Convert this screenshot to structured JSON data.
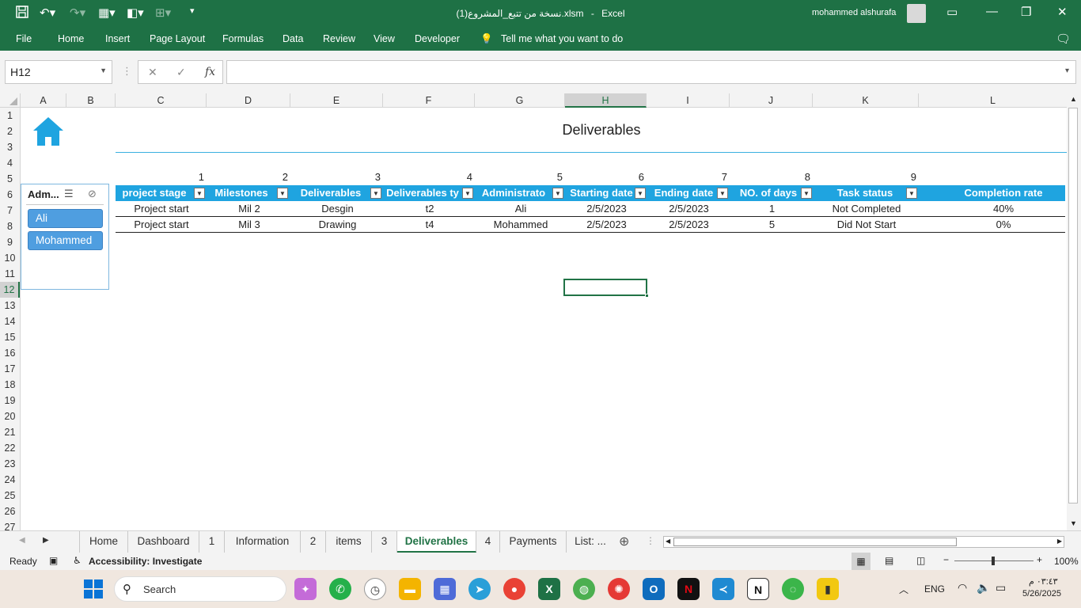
{
  "titlebar": {
    "filename": "نسخة من تتبع_المشروع(1).xlsm",
    "separator": "-",
    "app": "Excel",
    "user": "mohammed alshurafa"
  },
  "ribbon_tabs": [
    "File",
    "Home",
    "Insert",
    "Page Layout",
    "Formulas",
    "Data",
    "Review",
    "View",
    "Developer",
    "Tell me what you want to do"
  ],
  "formula_bar": {
    "name_box": "H12",
    "fx": "fx",
    "cancel": "✕",
    "enter": "✓",
    "value": ""
  },
  "columns": [
    "A",
    "B",
    "C",
    "D",
    "E",
    "F",
    "G",
    "H",
    "I",
    "J",
    "K",
    "L"
  ],
  "rows": [
    "1",
    "2",
    "3",
    "4",
    "5",
    "6",
    "7",
    "8",
    "9",
    "10",
    "11",
    "12",
    "13",
    "14",
    "15",
    "16",
    "17",
    "18",
    "19",
    "20",
    "21",
    "22",
    "23",
    "24",
    "25",
    "26",
    "27"
  ],
  "selected": {
    "column": "H",
    "row": "12"
  },
  "sheet": {
    "title": "Deliverables",
    "column_numbers": [
      "1",
      "2",
      "3",
      "4",
      "5",
      "6",
      "7",
      "8",
      "9"
    ],
    "headers": [
      "project stage",
      "Milestones",
      "Deliverables",
      "Deliverables ty",
      "Administrato",
      "Starting date",
      "Ending date",
      "NO. of days",
      "Task status",
      "Completion rate"
    ],
    "rows": [
      [
        "Project start",
        "Mil 2",
        "Desgin",
        "t2",
        "Ali",
        "2/5/2023",
        "2/5/2023",
        "1",
        "Not Completed",
        "40%"
      ],
      [
        "Project start",
        "Mil 3",
        "Drawing",
        "t4",
        "Mohammed",
        "2/5/2023",
        "2/5/2023",
        "5",
        "Did Not Start",
        "0%"
      ]
    ]
  },
  "slicer": {
    "title": "Adm...",
    "items": [
      "Ali",
      "Mohammed"
    ]
  },
  "sheet_tabs": [
    "Home",
    "Dashboard",
    "1",
    "Information",
    "2",
    "items",
    "3",
    "Deliverables",
    "4",
    "Payments",
    "List: ..."
  ],
  "active_tab": "Deliverables",
  "status_bar": {
    "ready": "Ready",
    "accessibility": "Accessibility: Investigate",
    "zoom": "100%"
  },
  "taskbar": {
    "search_placeholder": "Search",
    "lang": "ENG",
    "time": "٠٣:٤٣ م",
    "date": "5/26/2025"
  },
  "colors": {
    "excel_green": "#1e7145",
    "table_header": "#1fa4e0",
    "slicer_button": "#4f9ee0"
  }
}
